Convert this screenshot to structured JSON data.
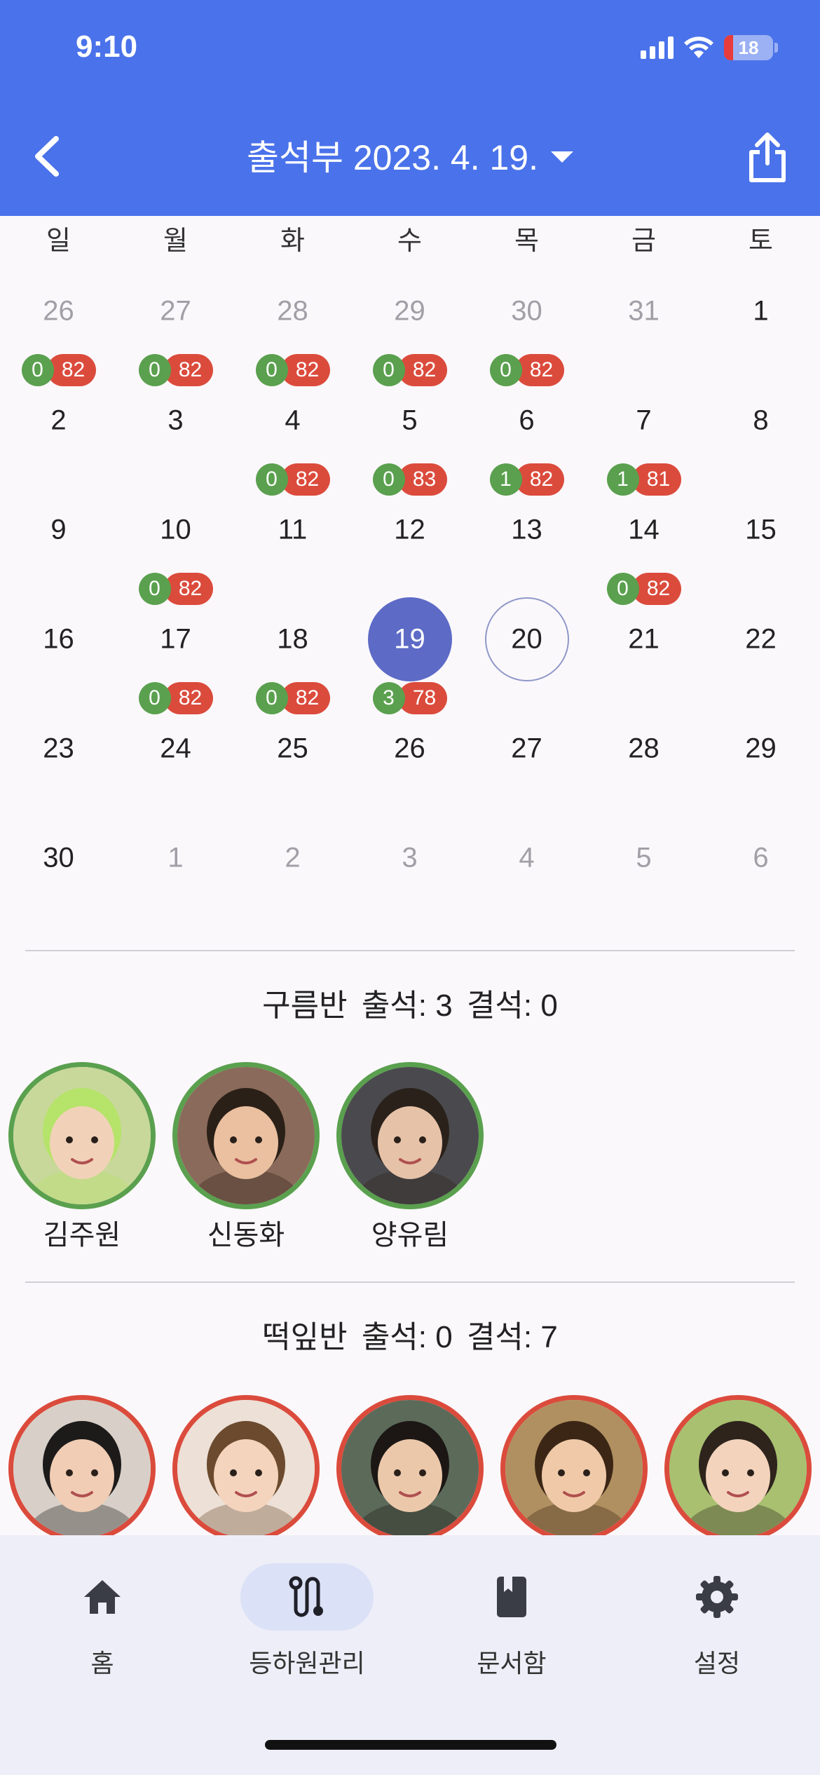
{
  "status_bar": {
    "time": "9:10",
    "battery": "18"
  },
  "header": {
    "title": "출석부 2023. 4. 19."
  },
  "weekdays": [
    "일",
    "월",
    "화",
    "수",
    "목",
    "금",
    "토"
  ],
  "calendar": {
    "weeks": [
      [
        {
          "day": "26",
          "other": true,
          "present": "0",
          "absent": "82"
        },
        {
          "day": "27",
          "other": true,
          "present": "0",
          "absent": "82"
        },
        {
          "day": "28",
          "other": true,
          "present": "0",
          "absent": "82"
        },
        {
          "day": "29",
          "other": true,
          "present": "0",
          "absent": "82"
        },
        {
          "day": "30",
          "other": true,
          "present": "0",
          "absent": "82"
        },
        {
          "day": "31",
          "other": true
        },
        {
          "day": "1"
        }
      ],
      [
        {
          "day": "2"
        },
        {
          "day": "3"
        },
        {
          "day": "4",
          "present": "0",
          "absent": "82"
        },
        {
          "day": "5",
          "present": "0",
          "absent": "83"
        },
        {
          "day": "6",
          "present": "1",
          "absent": "82"
        },
        {
          "day": "7",
          "present": "1",
          "absent": "81"
        },
        {
          "day": "8"
        }
      ],
      [
        {
          "day": "9"
        },
        {
          "day": "10",
          "present": "0",
          "absent": "82"
        },
        {
          "day": "11"
        },
        {
          "day": "12"
        },
        {
          "day": "13"
        },
        {
          "day": "14",
          "present": "0",
          "absent": "82"
        },
        {
          "day": "15"
        }
      ],
      [
        {
          "day": "16"
        },
        {
          "day": "17",
          "present": "0",
          "absent": "82"
        },
        {
          "day": "18",
          "present": "0",
          "absent": "82"
        },
        {
          "day": "19",
          "selected": true,
          "present": "3",
          "absent": "78"
        },
        {
          "day": "20",
          "today": true
        },
        {
          "day": "21"
        },
        {
          "day": "22"
        }
      ],
      [
        {
          "day": "23"
        },
        {
          "day": "24"
        },
        {
          "day": "25"
        },
        {
          "day": "26"
        },
        {
          "day": "27"
        },
        {
          "day": "28"
        },
        {
          "day": "29"
        }
      ],
      [
        {
          "day": "30"
        },
        {
          "day": "1",
          "other": true
        },
        {
          "day": "2",
          "other": true
        },
        {
          "day": "3",
          "other": true
        },
        {
          "day": "4",
          "other": true
        },
        {
          "day": "5",
          "other": true
        },
        {
          "day": "6",
          "other": true
        }
      ]
    ]
  },
  "classes": [
    {
      "summary": {
        "name": "구름반",
        "present_label": "출석: 3",
        "absent_label": "결석: 0"
      },
      "children": [
        {
          "name": "김주원",
          "status": "present",
          "photo": {
            "bg": "#c8d89a",
            "skin": "#f1d2b8",
            "hair": "#b6e36a"
          }
        },
        {
          "name": "신동화",
          "status": "present",
          "photo": {
            "bg": "#8a6a5a",
            "skin": "#eac0a0",
            "hair": "#2b2018"
          }
        },
        {
          "name": "양유림",
          "status": "present",
          "photo": {
            "bg": "#4a4a4e",
            "skin": "#e6c2a8",
            "hair": "#2a211b"
          }
        }
      ]
    },
    {
      "summary": {
        "name": "떡잎반",
        "present_label": "출석: 0",
        "absent_label": "결석: 7"
      },
      "children": [
        {
          "name": "",
          "status": "absent",
          "photo": {
            "bg": "#d8d0c8",
            "skin": "#f0cdb4",
            "hair": "#1d1a1a"
          }
        },
        {
          "name": "",
          "status": "absent",
          "photo": {
            "bg": "#ede0d6",
            "skin": "#f4d4bc",
            "hair": "#6b4a2e"
          }
        },
        {
          "name": "",
          "status": "absent",
          "photo": {
            "bg": "#5c6a5a",
            "skin": "#ecc8aa",
            "hair": "#1c1714"
          }
        },
        {
          "name": "",
          "status": "absent",
          "photo": {
            "bg": "#b09060",
            "skin": "#f0caa8",
            "hair": "#3b2616"
          }
        },
        {
          "name": "",
          "status": "absent",
          "photo": {
            "bg": "#a8c070",
            "skin": "#f3d3bc",
            "hair": "#2e241c"
          }
        }
      ]
    }
  ],
  "nav": [
    {
      "label": "홈",
      "icon": "home-icon",
      "active": false
    },
    {
      "label": "등하원관리",
      "icon": "route-icon",
      "active": true
    },
    {
      "label": "문서함",
      "icon": "book-icon",
      "active": false
    },
    {
      "label": "설정",
      "icon": "gear-icon",
      "active": false
    }
  ]
}
